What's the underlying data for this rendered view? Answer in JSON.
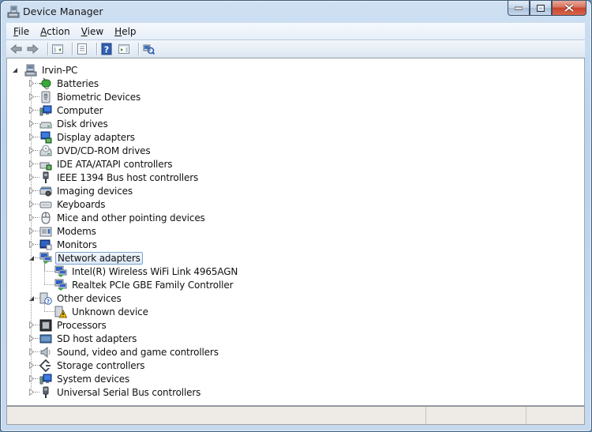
{
  "window": {
    "title": "Device Manager",
    "icon": "device-manager-icon",
    "caption_buttons": [
      "minimize",
      "maximize",
      "close"
    ]
  },
  "menu": [
    {
      "label": "File",
      "accel": "F"
    },
    {
      "label": "Action",
      "accel": "A"
    },
    {
      "label": "View",
      "accel": "V"
    },
    {
      "label": "Help",
      "accel": "H"
    }
  ],
  "toolbar": [
    {
      "name": "back-button",
      "icon": "arrow-left-icon"
    },
    {
      "name": "forward-button",
      "icon": "arrow-right-icon"
    },
    {
      "sep": true
    },
    {
      "name": "show-hide-console-tree-button",
      "icon": "console-tree-icon"
    },
    {
      "sep": true
    },
    {
      "name": "properties-button",
      "icon": "properties-icon"
    },
    {
      "sep": true
    },
    {
      "name": "help-button",
      "icon": "help-icon"
    },
    {
      "name": "show-hide-action-pane-button",
      "icon": "action-pane-icon"
    },
    {
      "sep": true
    },
    {
      "name": "scan-hardware-changes-button",
      "icon": "scan-hardware-icon"
    }
  ],
  "tree": {
    "root": {
      "label": "Irvin-PC",
      "icon": "computer-icon",
      "expanded": true
    },
    "categories": [
      {
        "label": "Batteries",
        "icon": "battery-icon",
        "expanded": false
      },
      {
        "label": "Biometric Devices",
        "icon": "biometric-icon",
        "expanded": false
      },
      {
        "label": "Computer",
        "icon": "computer-monitor-icon",
        "expanded": false
      },
      {
        "label": "Disk drives",
        "icon": "disk-drive-icon",
        "expanded": false
      },
      {
        "label": "Display adapters",
        "icon": "display-adapter-icon",
        "expanded": false
      },
      {
        "label": "DVD/CD-ROM drives",
        "icon": "dvd-drive-icon",
        "expanded": false
      },
      {
        "label": "IDE ATA/ATAPI controllers",
        "icon": "ide-controller-icon",
        "expanded": false
      },
      {
        "label": "IEEE 1394 Bus host controllers",
        "icon": "ieee1394-icon",
        "expanded": false
      },
      {
        "label": "Imaging devices",
        "icon": "imaging-device-icon",
        "expanded": false
      },
      {
        "label": "Keyboards",
        "icon": "keyboard-icon",
        "expanded": false
      },
      {
        "label": "Mice and other pointing devices",
        "icon": "mouse-icon",
        "expanded": false
      },
      {
        "label": "Modems",
        "icon": "modem-icon",
        "expanded": false
      },
      {
        "label": "Monitors",
        "icon": "monitor-icon",
        "expanded": false
      },
      {
        "label": "Network adapters",
        "icon": "network-adapter-icon",
        "expanded": true,
        "selected": true,
        "children": [
          {
            "label": "Intel(R) Wireless WiFi Link 4965AGN",
            "icon": "network-adapter-icon"
          },
          {
            "label": "Realtek PCIe GBE Family Controller",
            "icon": "network-adapter-icon"
          }
        ]
      },
      {
        "label": "Other devices",
        "icon": "unknown-device-icon",
        "expanded": true,
        "children": [
          {
            "label": "Unknown device",
            "icon": "warning-device-icon"
          }
        ]
      },
      {
        "label": "Processors",
        "icon": "processor-icon",
        "expanded": false
      },
      {
        "label": "SD host adapters",
        "icon": "sd-host-icon",
        "expanded": false
      },
      {
        "label": "Sound, video and game controllers",
        "icon": "speaker-icon",
        "expanded": false
      },
      {
        "label": "Storage controllers",
        "icon": "storage-controller-icon",
        "expanded": false
      },
      {
        "label": "System devices",
        "icon": "system-device-icon",
        "expanded": false
      },
      {
        "label": "Universal Serial Bus controllers",
        "icon": "usb-icon",
        "expanded": false
      }
    ]
  },
  "statusbar": {
    "panes": [
      "",
      "",
      ""
    ]
  }
}
